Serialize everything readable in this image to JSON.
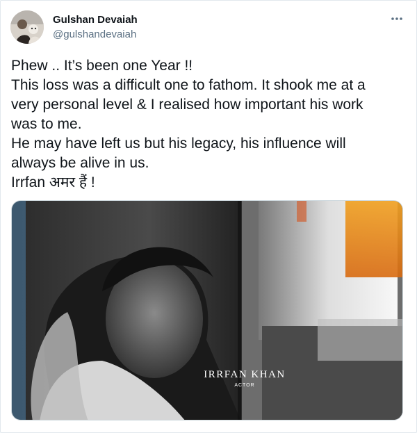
{
  "author": {
    "display_name": "Gulshan Devaiah",
    "handle": "@gulshandevaiah"
  },
  "icons": {
    "more": "more-horizontal-icon",
    "avatar": "profile-photo"
  },
  "tweet": {
    "lines": [
      "Phew .. It’s been one Year !!",
      "This loss was a difficult one to fathom. It shook me at a",
      "very personal level & I realised how important his work",
      "was to me.",
      "He may have left us but his legacy, his influence will",
      "always be alive in us.",
      "Irrfan अमर हैं !"
    ]
  },
  "media": {
    "caption_name": "IRRFAN KHAN",
    "caption_role": "ACTOR"
  },
  "colors": {
    "text": "#0f1419",
    "secondary": "#5b7083",
    "border": "#e1e8ed"
  }
}
